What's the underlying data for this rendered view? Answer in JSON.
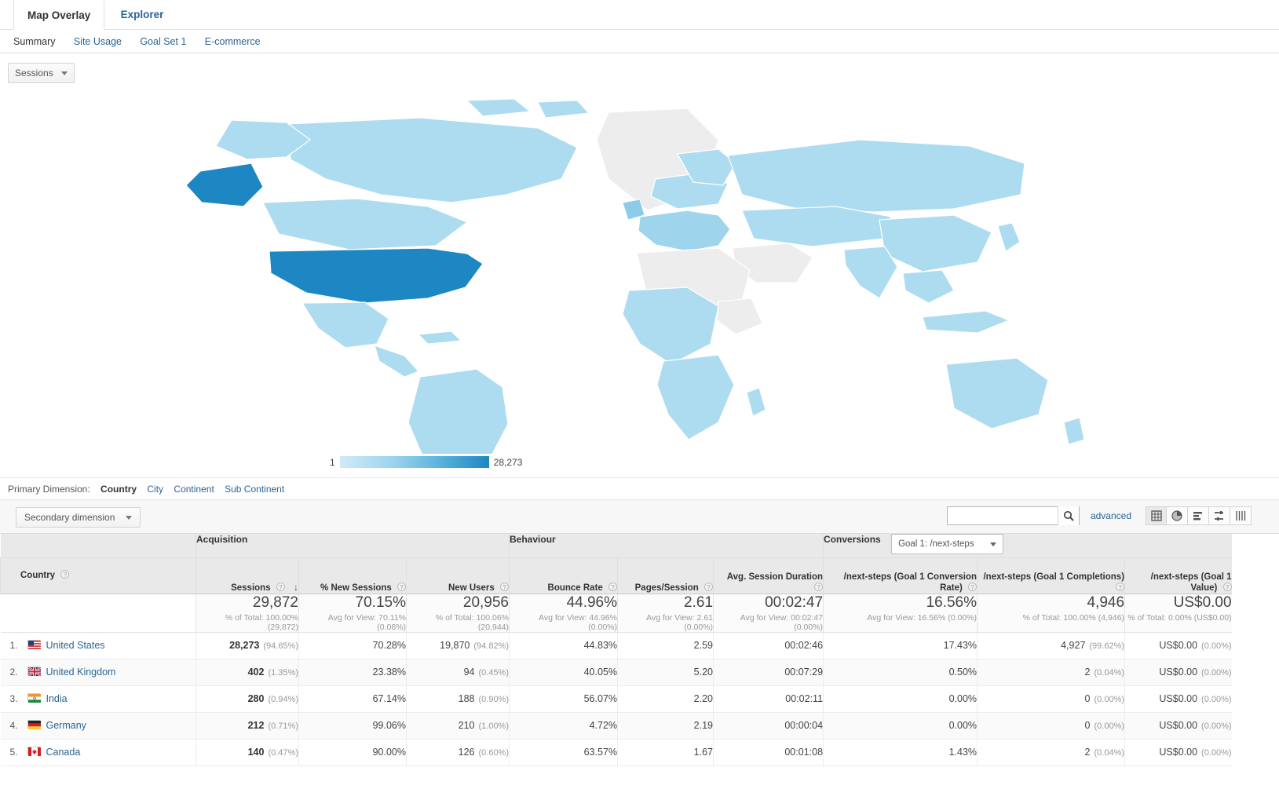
{
  "tabs": [
    {
      "label": "Map Overlay",
      "active": true
    },
    {
      "label": "Explorer",
      "active": false
    }
  ],
  "subtabs": [
    {
      "label": "Summary",
      "active": true
    },
    {
      "label": "Site Usage",
      "active": false
    },
    {
      "label": "Goal Set 1",
      "active": false
    },
    {
      "label": "E-commerce",
      "active": false
    }
  ],
  "metric_selector": {
    "label": "Sessions"
  },
  "map": {
    "legend_min": "1",
    "legend_max": "28,273",
    "color_low": "#cfeaf7",
    "color_high": "#1c87c3",
    "no_data_color": "#eeeeee"
  },
  "primary_dimension": {
    "label": "Primary Dimension:",
    "options": [
      {
        "label": "Country",
        "active": true
      },
      {
        "label": "City",
        "active": false
      },
      {
        "label": "Continent",
        "active": false
      },
      {
        "label": "Sub Continent",
        "active": false
      }
    ]
  },
  "toolbar": {
    "secondary_dimension": "Secondary dimension",
    "search_value": "",
    "search_placeholder": "",
    "advanced": "advanced",
    "view_icons": [
      {
        "name": "table-view-icon",
        "active": true
      },
      {
        "name": "pie-chart-view-icon",
        "active": false
      },
      {
        "name": "performance-view-icon",
        "active": false
      },
      {
        "name": "comparison-view-icon",
        "active": false
      },
      {
        "name": "pivot-view-icon",
        "active": false
      }
    ]
  },
  "table": {
    "groups": [
      {
        "label": "Acquisition",
        "span": 3
      },
      {
        "label": "Behaviour",
        "span": 3
      },
      {
        "label": "Conversions",
        "span": 3,
        "select": "Goal 1: /next-steps"
      }
    ],
    "columns": [
      {
        "label": "Country",
        "align": "left",
        "help": true
      },
      {
        "label": "Sessions",
        "help": true,
        "sorted": true,
        "sort_dir": "desc"
      },
      {
        "label": "% New Sessions",
        "help": true
      },
      {
        "label": "New Users",
        "help": true
      },
      {
        "label": "Bounce Rate",
        "help": true
      },
      {
        "label": "Pages/Session",
        "help": true
      },
      {
        "label": "Avg. Session Duration",
        "help": true
      },
      {
        "label": "/next-steps (Goal 1 Conversion Rate)",
        "help": true
      },
      {
        "label": "/next-steps (Goal 1 Completions)",
        "help": true
      },
      {
        "label": "/next-steps (Goal 1 Value)",
        "help": true
      }
    ],
    "summary": [
      {
        "big": "",
        "sub": ""
      },
      {
        "big": "29,872",
        "sub": "% of Total: 100.00% (29,872)"
      },
      {
        "big": "70.15%",
        "sub": "Avg for View: 70.11% (0.06%)"
      },
      {
        "big": "20,956",
        "sub": "% of Total: 100.06% (20,944)"
      },
      {
        "big": "44.96%",
        "sub": "Avg for View: 44.96% (0.00%)"
      },
      {
        "big": "2.61",
        "sub": "Avg for View: 2.61 (0.00%)"
      },
      {
        "big": "00:02:47",
        "sub": "Avg for View: 00:02:47 (0.00%)"
      },
      {
        "big": "16.56%",
        "sub": "Avg for View: 16.56% (0.00%)"
      },
      {
        "big": "4,946",
        "sub": "% of Total: 100.00% (4,946)"
      },
      {
        "big": "US$0.00",
        "sub": "% of Total: 0.00% (US$0.00)"
      }
    ],
    "rows": [
      {
        "num": "1.",
        "country": "United States",
        "flag": "us",
        "sessions": "28,273",
        "sessions_pct": "(94.65%)",
        "new_sessions": "70.28%",
        "new_users": "19,870",
        "new_users_pct": "(94.82%)",
        "bounce_rate": "44.83%",
        "pages_session": "2.59",
        "avg_duration": "00:02:46",
        "goal_conv_rate": "17.43%",
        "goal_completions": "4,927",
        "goal_completions_pct": "(99.62%)",
        "goal_value": "US$0.00",
        "goal_value_pct": "(0.00%)"
      },
      {
        "num": "2.",
        "country": "United Kingdom",
        "flag": "gb",
        "sessions": "402",
        "sessions_pct": "(1.35%)",
        "new_sessions": "23.38%",
        "new_users": "94",
        "new_users_pct": "(0.45%)",
        "bounce_rate": "40.05%",
        "pages_session": "5.20",
        "avg_duration": "00:07:29",
        "goal_conv_rate": "0.50%",
        "goal_completions": "2",
        "goal_completions_pct": "(0.04%)",
        "goal_value": "US$0.00",
        "goal_value_pct": "(0.00%)"
      },
      {
        "num": "3.",
        "country": "India",
        "flag": "in",
        "sessions": "280",
        "sessions_pct": "(0.94%)",
        "new_sessions": "67.14%",
        "new_users": "188",
        "new_users_pct": "(0.90%)",
        "bounce_rate": "56.07%",
        "pages_session": "2.20",
        "avg_duration": "00:02:11",
        "goal_conv_rate": "0.00%",
        "goal_completions": "0",
        "goal_completions_pct": "(0.00%)",
        "goal_value": "US$0.00",
        "goal_value_pct": "(0.00%)"
      },
      {
        "num": "4.",
        "country": "Germany",
        "flag": "de",
        "sessions": "212",
        "sessions_pct": "(0.71%)",
        "new_sessions": "99.06%",
        "new_users": "210",
        "new_users_pct": "(1.00%)",
        "bounce_rate": "4.72%",
        "pages_session": "2.19",
        "avg_duration": "00:00:04",
        "goal_conv_rate": "0.00%",
        "goal_completions": "0",
        "goal_completions_pct": "(0.00%)",
        "goal_value": "US$0.00",
        "goal_value_pct": "(0.00%)"
      },
      {
        "num": "5.",
        "country": "Canada",
        "flag": "ca",
        "sessions": "140",
        "sessions_pct": "(0.47%)",
        "new_sessions": "90.00%",
        "new_users": "126",
        "new_users_pct": "(0.60%)",
        "bounce_rate": "63.57%",
        "pages_session": "1.67",
        "avg_duration": "00:01:08",
        "goal_conv_rate": "1.43%",
        "goal_completions": "2",
        "goal_completions_pct": "(0.04%)",
        "goal_value": "US$0.00",
        "goal_value_pct": "(0.00%)"
      }
    ]
  },
  "chart_data": {
    "type": "map",
    "title": "Sessions by Country",
    "metric": "Sessions",
    "scale_min": 1,
    "scale_max": 28273,
    "categories": [
      "United States",
      "United Kingdom",
      "India",
      "Germany",
      "Canada"
    ],
    "values": [
      28273,
      402,
      280,
      212,
      140
    ]
  }
}
